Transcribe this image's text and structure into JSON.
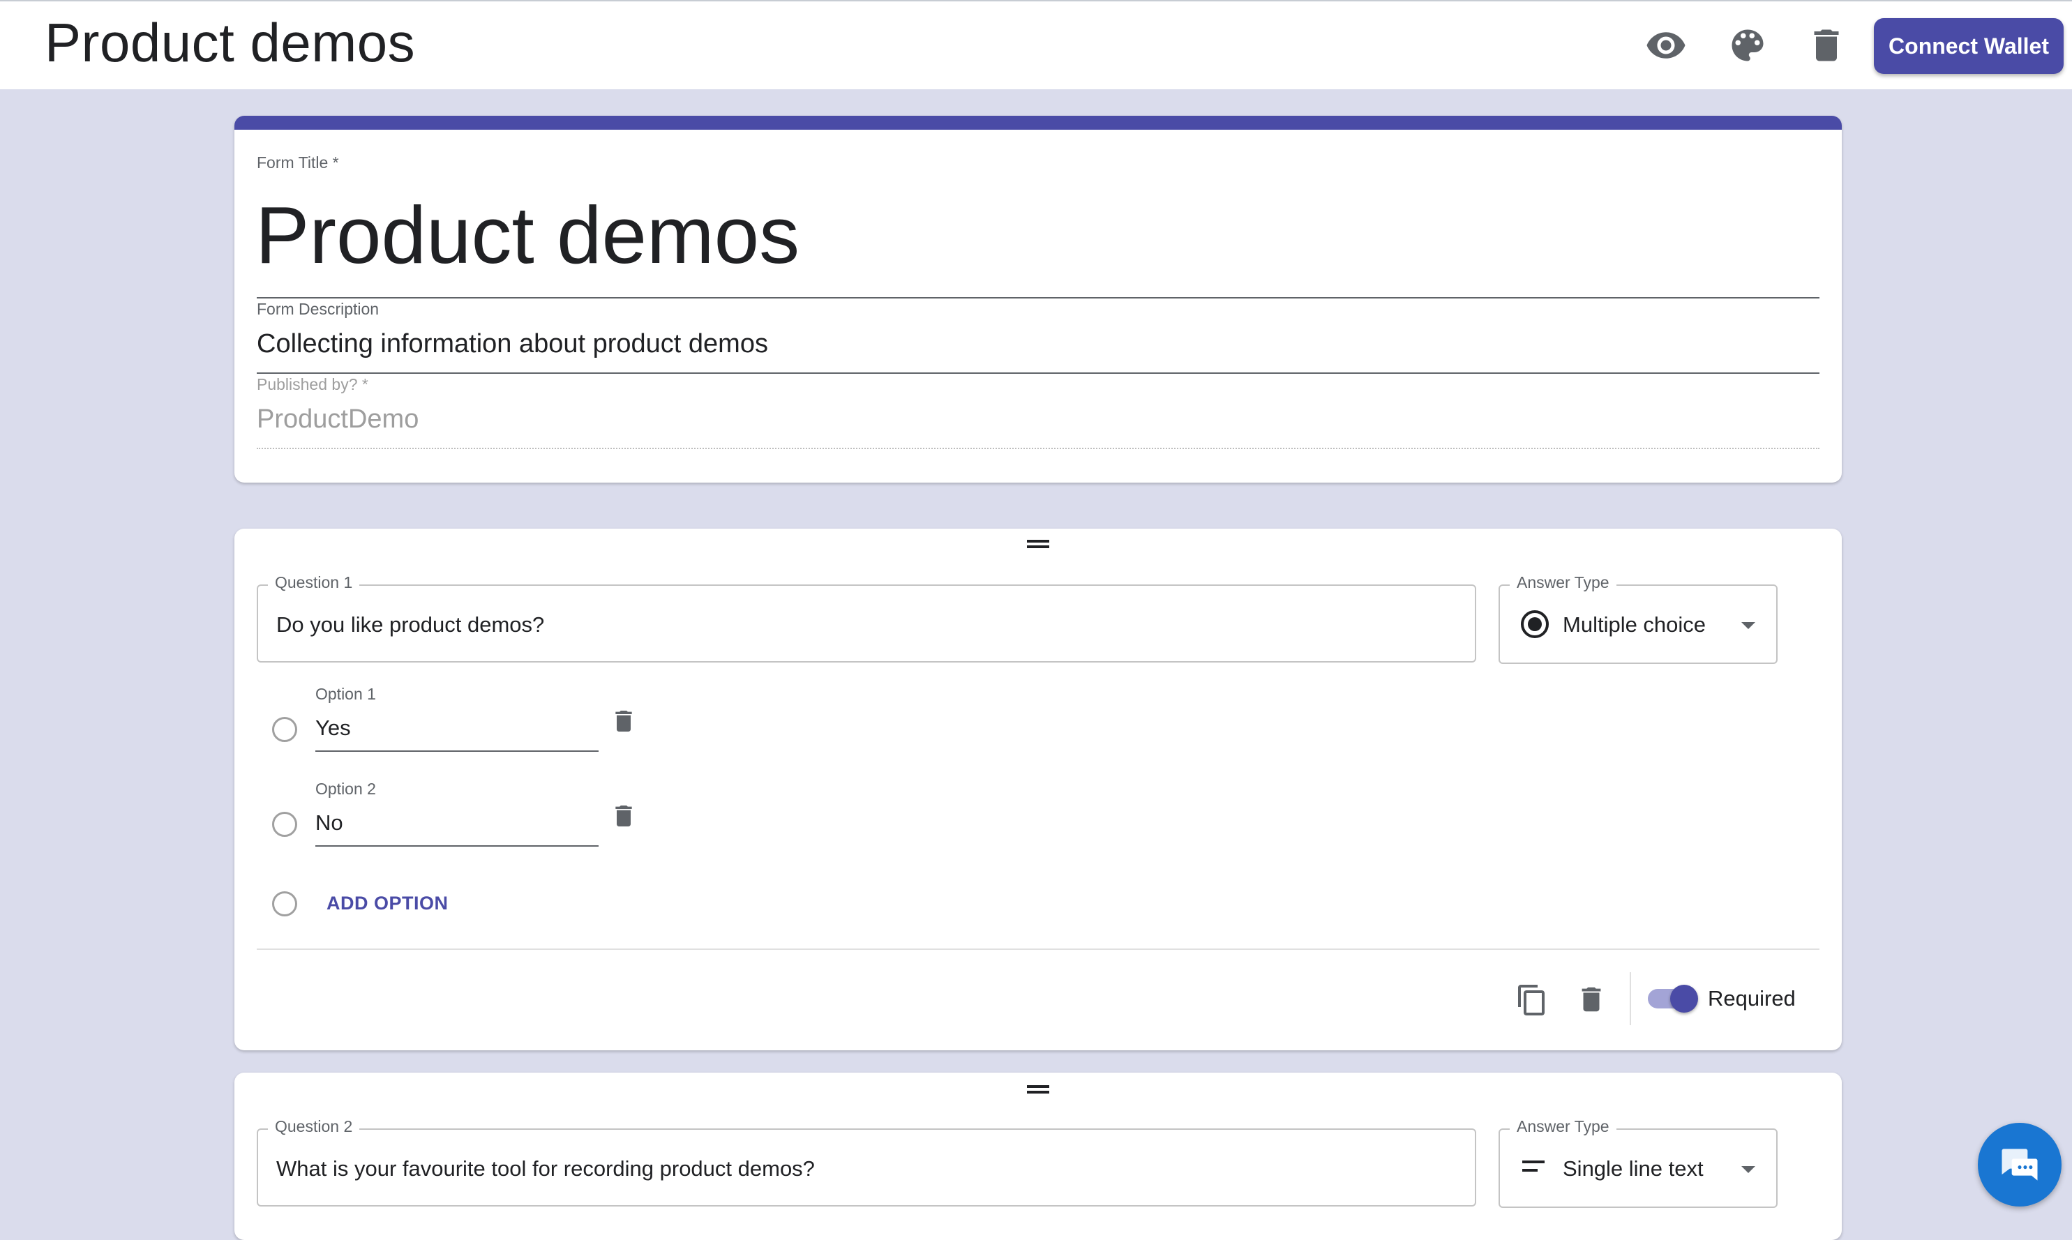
{
  "app": {
    "title": "Product demos"
  },
  "toolbar": {
    "preview_icon": "eye-icon",
    "theme_icon": "palette-icon",
    "delete_icon": "trash-icon",
    "connect_wallet_label": "Connect Wallet"
  },
  "header_form": {
    "title_label": "Form Title *",
    "title_value": "Product demos",
    "description_label": "Form Description",
    "description_value": "Collecting information about product demos",
    "publisher_label": "Published by? *",
    "publisher_value": "ProductDemo"
  },
  "questions": [
    {
      "label": "Question 1",
      "value": "Do you like product demos?",
      "answer_type_label": "Answer Type",
      "answer_type_value": "Multiple choice",
      "answer_type_icon": "radio-checked-icon",
      "options": [
        {
          "label": "Option 1",
          "value": "Yes"
        },
        {
          "label": "Option 2",
          "value": "No"
        }
      ],
      "add_option_label": "ADD OPTION",
      "required_label": "Required",
      "required": true
    },
    {
      "label": "Question 2",
      "value": "What is your favourite tool for recording product demos?",
      "answer_type_label": "Answer Type",
      "answer_type_value": "Single line text",
      "answer_type_icon": "short-text-icon"
    }
  ],
  "colors": {
    "accent": "#4a4ba6",
    "background": "#dadcec",
    "chat_button": "#1976d2"
  }
}
